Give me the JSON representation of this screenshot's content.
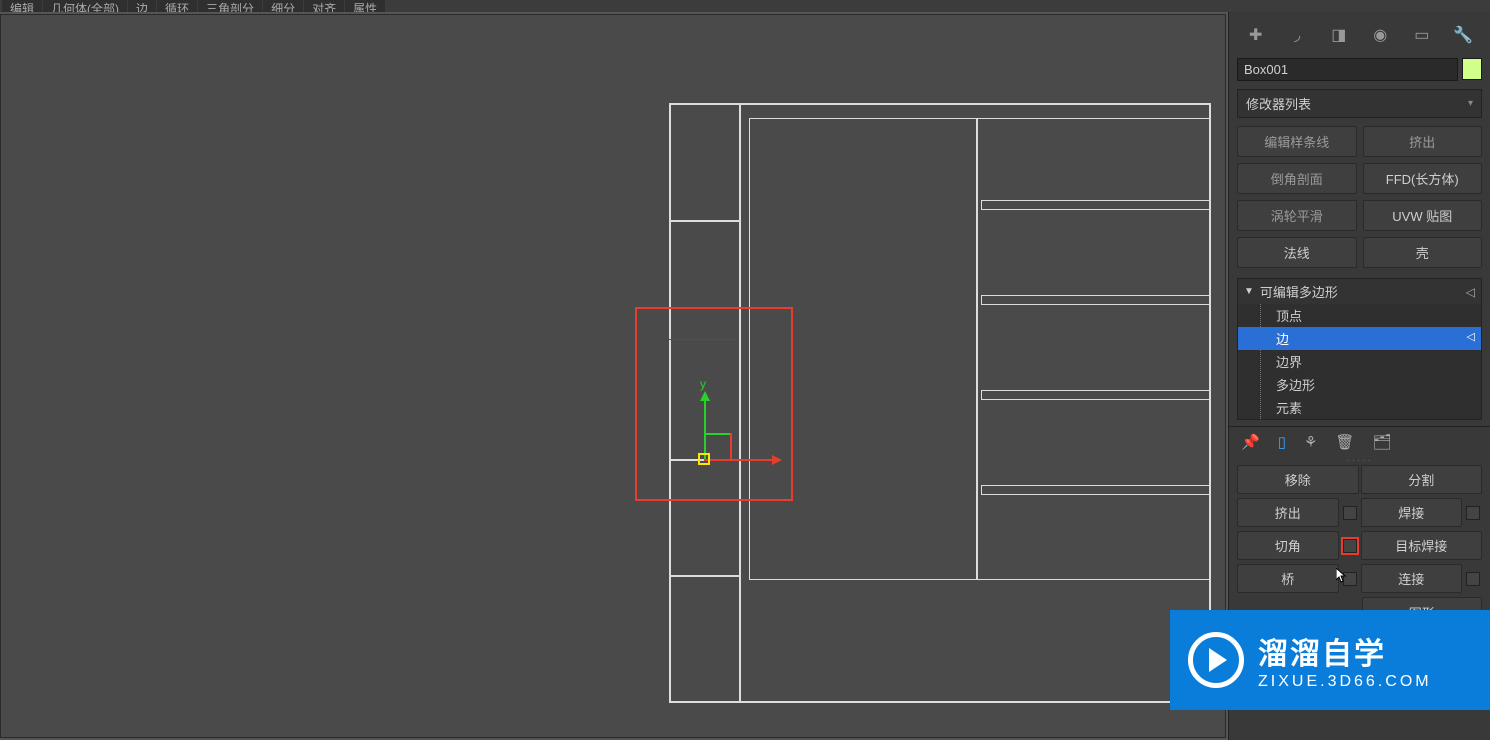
{
  "topmenu": [
    "编辑",
    "几何体(全部)",
    "边",
    "循环",
    "三角剖分",
    "细分",
    "对齐",
    "属性"
  ],
  "object_name": "Box001",
  "modifier_list_label": "修改器列表",
  "mod_buttons": {
    "edit_spline": "编辑样条线",
    "extrude": "挤出",
    "bevel_profile": "倒角剖面",
    "ffd_box": "FFD(长方体)",
    "turbosmooth": "涡轮平滑",
    "uvw_map": "UVW 贴图",
    "normal": "法线",
    "shell": "壳"
  },
  "stack": {
    "header": "可编辑多边形",
    "items": [
      "顶点",
      "边",
      "边界",
      "多边形",
      "元素"
    ],
    "selected_index": 1
  },
  "edit_edges": {
    "remove": "移除",
    "split": "分割",
    "extrude": "挤出",
    "weld": "焊接",
    "chamfer": "切角",
    "target_weld": "目标焊接",
    "bridge": "桥",
    "connect": "连接",
    "shape_partial": "图形"
  },
  "watermark": {
    "title": "溜溜自学",
    "url": "ZIXUE.3D66.COM"
  }
}
